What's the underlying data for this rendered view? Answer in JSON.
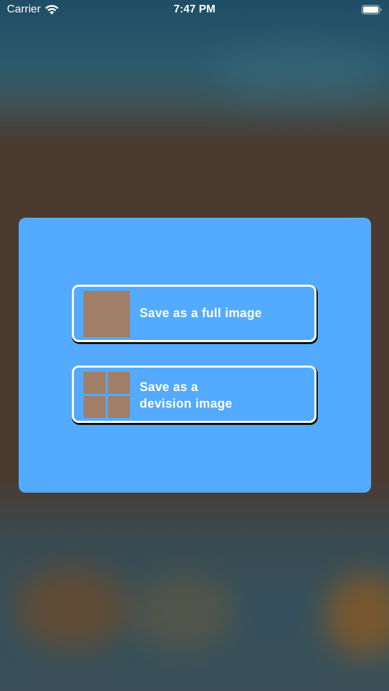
{
  "status_bar": {
    "carrier": "Carrier",
    "time": "7:47 PM",
    "icons": [
      "wifi-icon",
      "battery-icon"
    ]
  },
  "dialog": {
    "options": [
      {
        "lines": [
          "Save as a full image"
        ],
        "icon": "single-square-thumbnail"
      },
      {
        "lines": [
          "Save as a",
          "devision image"
        ],
        "icon": "four-square-grid-thumbnail"
      }
    ],
    "colors": {
      "card_background": "#53aaff",
      "thumbnail": "#a07e68",
      "text": "#ffffff"
    }
  }
}
